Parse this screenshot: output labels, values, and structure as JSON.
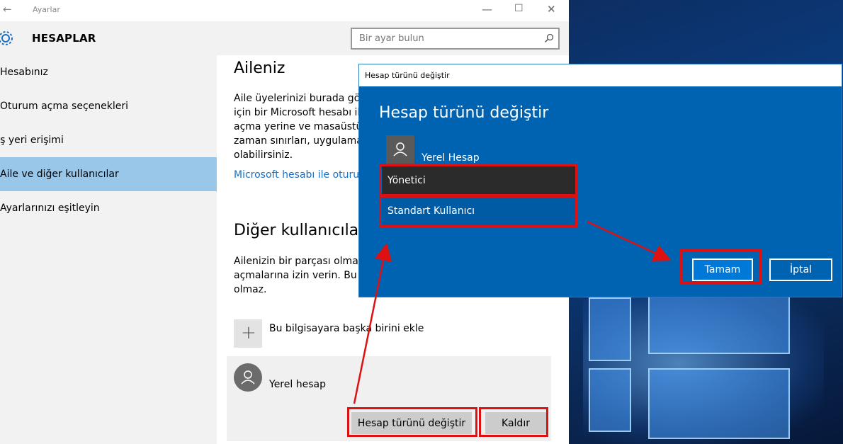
{
  "window": {
    "title": "Ayarlar",
    "back_icon": "arrow-left-icon",
    "controls": [
      "minimize-icon",
      "maximize-icon",
      "close-icon"
    ]
  },
  "header": {
    "icon": "gear-icon",
    "title": "HESAPLAR",
    "search_placeholder": "Bir ayar bulun",
    "search_icon": "magnifier-icon"
  },
  "sidebar": {
    "items": [
      {
        "label": "Hesabınız",
        "active": false
      },
      {
        "label": "Oturum açma seçenekleri",
        "active": false
      },
      {
        "label": "İş yeri erişimi",
        "active": false
      },
      {
        "label": "Aile ve diğer kullanıcılar",
        "active": true
      },
      {
        "label": "Ayarlarınızı eşitleyin",
        "active": false
      }
    ]
  },
  "main": {
    "family_heading": "Aileniz",
    "family_para": [
      "Aile üyelerinizi burada görı",
      "için bir Microsoft hesabı ile",
      "açma yerine ve masaüstün",
      "zaman sınırları, uygulama v",
      "olabilirsiniz."
    ],
    "family_link": "Microsoft hesabı ile oturun",
    "others_heading": "Diğer kullanıcılar",
    "others_para": [
      "Ailenizin bir parçası olmaya",
      "açmalarına izin verin. Bu du",
      "olmaz."
    ],
    "add_user_label": "Bu bilgisayara başka birini ekle",
    "user_name": "Yerel hesap",
    "change_type_button": "Hesap türünü değiştir",
    "remove_button": "Kaldır"
  },
  "dialog": {
    "window_title": "Hesap türünü değiştir",
    "heading": "Hesap türünü değiştir",
    "account_name": "Yerel Hesap",
    "options": [
      "Yönetici",
      "Standart Kullanıcı"
    ],
    "selected_option": "Yönetici",
    "ok_button": "Tamam",
    "cancel_button": "İptal"
  },
  "colors": {
    "accent": "#0063b1",
    "sidebar_active": "#99c7ea",
    "annotation_red": "#dd1111"
  }
}
